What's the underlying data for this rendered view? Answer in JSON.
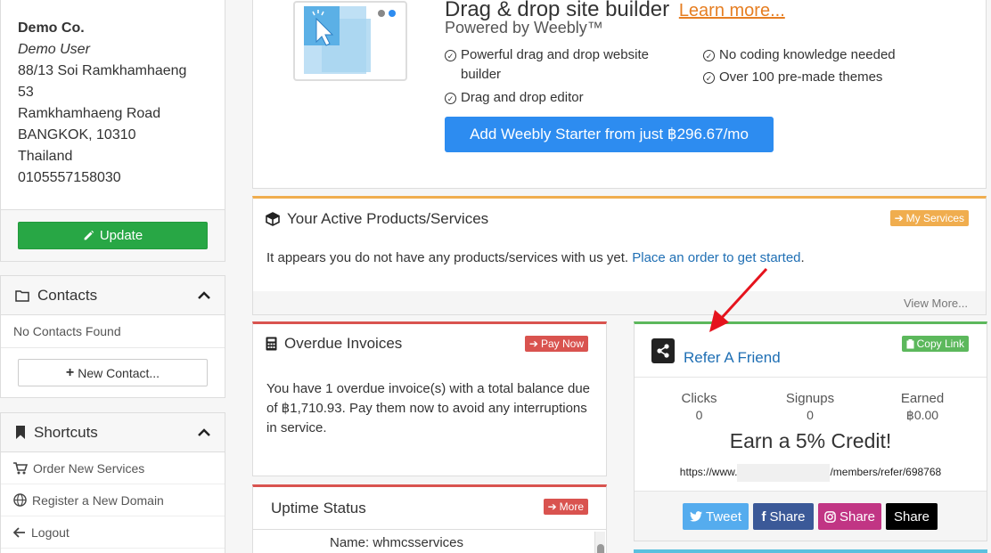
{
  "address": {
    "company": "Demo Co.",
    "user": "Demo User",
    "lines": [
      "88/13 Soi Ramkhamhaeng",
      "53",
      "Ramkhamhaeng Road",
      "BANGKOK, 10310",
      "Thailand",
      "0105557158030"
    ],
    "update_label": "Update"
  },
  "contacts": {
    "title": "Contacts",
    "empty_text": "No Contacts Found",
    "new_label": "New Contact..."
  },
  "shortcuts": {
    "title": "Shortcuts",
    "items": [
      {
        "label": "Order New Services",
        "icon": "cart-icon"
      },
      {
        "label": "Register a New Domain",
        "icon": "globe-icon"
      },
      {
        "label": "Logout",
        "icon": "arrow-left-icon"
      }
    ]
  },
  "promo": {
    "title": "Drag & drop site builder",
    "learn_more": "Learn more...",
    "subtitle": "Powered by Weebly™",
    "features_left": [
      "Powerful drag and drop website builder",
      "Drag and drop editor"
    ],
    "features_right": [
      "No coding knowledge needed",
      "Over 100 pre-made themes"
    ],
    "button_label": "Add Weebly Starter from just ฿296.67/mo"
  },
  "active": {
    "title": "Your Active Products/Services",
    "badge": "My Services",
    "text": "It appears you do not have any products/services with us yet.",
    "link": "Place an order to get started",
    "link_suffix": ".",
    "footer": "View More..."
  },
  "overdue": {
    "title": "Overdue Invoices",
    "badge": "Pay Now",
    "text": "You have 1 overdue invoice(s) with a total balance due of ฿1,710.93. Pay them now to avoid any interruptions in service."
  },
  "uptime": {
    "title": "Uptime Status",
    "badge": "More",
    "row": "Name: whmcsservices"
  },
  "refer": {
    "title": "Refer A Friend",
    "badge": "Copy Link",
    "stats": [
      {
        "label": "Clicks",
        "value": "0"
      },
      {
        "label": "Signups",
        "value": "0"
      },
      {
        "label": "Earned",
        "value": "฿0.00"
      }
    ],
    "earn_text": "Earn a 5% Credit!",
    "link_prefix": "https://www.",
    "link_suffix": "/members/refer/698768",
    "share_buttons": [
      {
        "label": "Tweet",
        "color": "#55acee"
      },
      {
        "label": "Share",
        "color": "#3b5998"
      },
      {
        "label": "Share",
        "color": "#c13584"
      },
      {
        "label": "Share",
        "color": "#000000"
      }
    ]
  },
  "colors": {
    "accent_blue": "#2d8cf0",
    "green": "#28a745",
    "orange": "#f0ad4e",
    "red": "#d9534f",
    "annotation_arrow": "#e5131d"
  }
}
